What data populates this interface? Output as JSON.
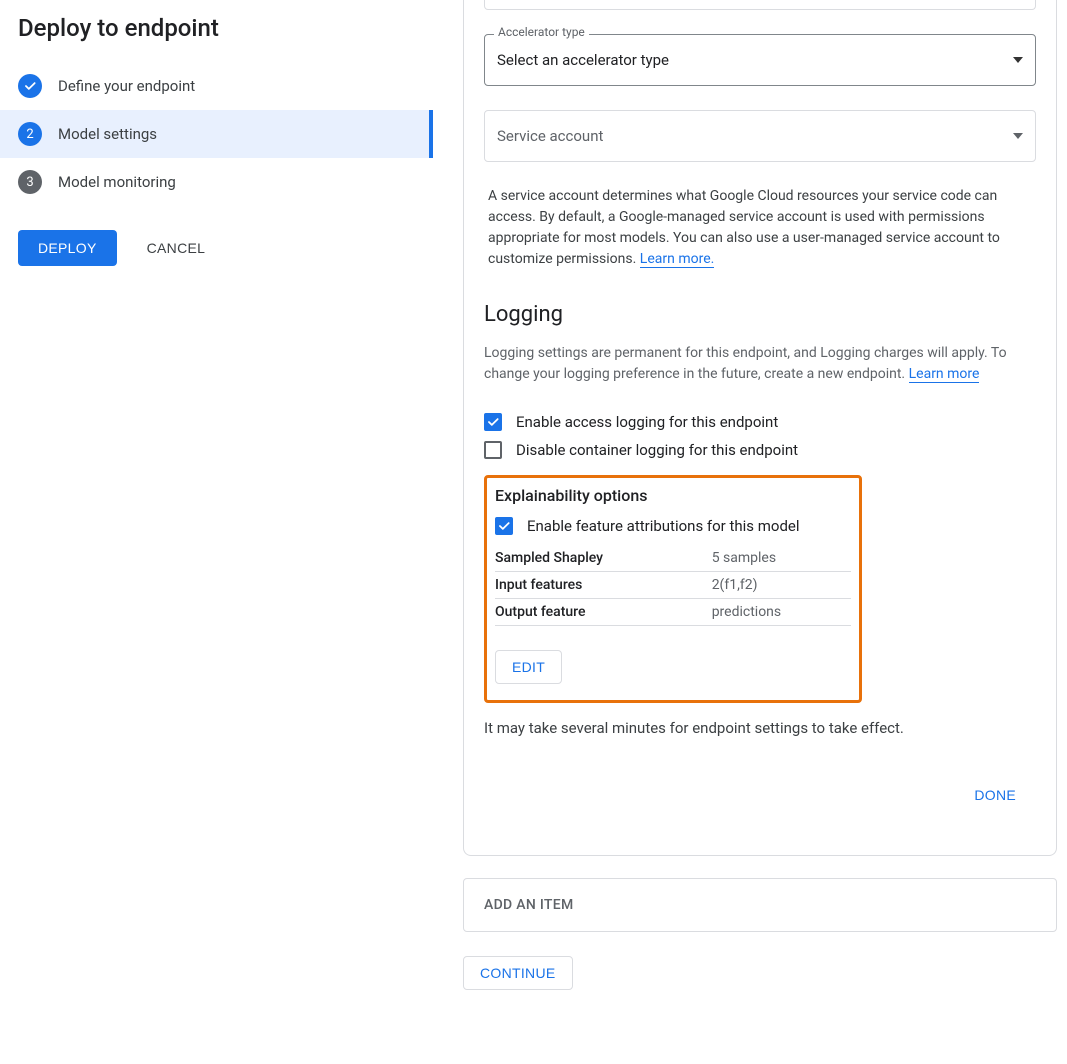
{
  "sidebar": {
    "title": "Deploy to endpoint",
    "steps": [
      {
        "label": "Define your endpoint",
        "state": "done"
      },
      {
        "label": "Model settings",
        "state": "active",
        "num": "2"
      },
      {
        "label": "Model monitoring",
        "state": "pending",
        "num": "3"
      }
    ],
    "deploy": "DEPLOY",
    "cancel": "CANCEL"
  },
  "main": {
    "accelerator": {
      "label": "Accelerator type",
      "value": "Select an accelerator type"
    },
    "serviceAccount": {
      "placeholder": "Service account",
      "helper_prefix": "A service account determines what Google Cloud resources your service code can access. By default, a Google-managed service account is used with permissions appropriate for most models. You can also use a user-managed service account to customize permissions. ",
      "learn_more": "Learn more."
    },
    "logging": {
      "title": "Logging",
      "desc_prefix": "Logging settings are permanent for this endpoint, and Logging charges will apply. To change your logging preference in the future, create a new endpoint. ",
      "learn_more": "Learn more",
      "enable_access": "Enable access logging for this endpoint",
      "disable_container": "Disable container logging for this endpoint"
    },
    "explain": {
      "title": "Explainability options",
      "enable_attr": "Enable feature attributions for this model",
      "rows": [
        {
          "k": "Sampled Shapley",
          "v": "5 samples"
        },
        {
          "k": "Input features",
          "v": "2(f1,f2)"
        },
        {
          "k": "Output feature",
          "v": "predictions"
        }
      ],
      "edit": "EDIT"
    },
    "note": "It may take several minutes for endpoint settings to take effect.",
    "done": "DONE",
    "add_item": "ADD AN ITEM",
    "continue": "CONTINUE"
  }
}
